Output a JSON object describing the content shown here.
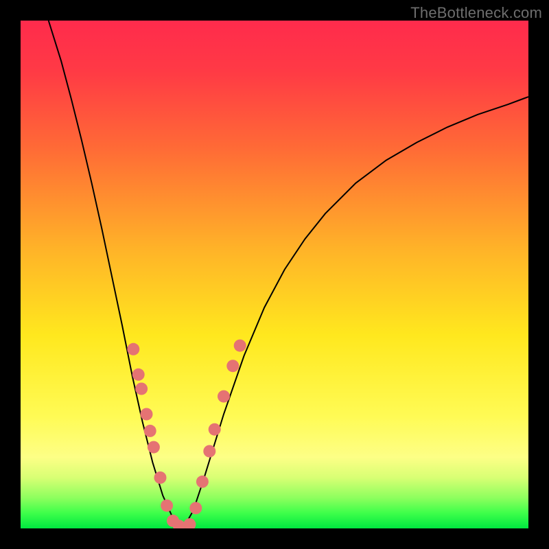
{
  "watermark": {
    "text": "TheBottleneck.com"
  },
  "gradient": {
    "stops": [
      {
        "offset": 0.0,
        "color": "#ff2b4c"
      },
      {
        "offset": 0.1,
        "color": "#ff3a45"
      },
      {
        "offset": 0.25,
        "color": "#ff6a36"
      },
      {
        "offset": 0.45,
        "color": "#ffb328"
      },
      {
        "offset": 0.62,
        "color": "#ffe81e"
      },
      {
        "offset": 0.78,
        "color": "#fffb55"
      },
      {
        "offset": 0.86,
        "color": "#fdff86"
      },
      {
        "offset": 0.9,
        "color": "#d8ff74"
      },
      {
        "offset": 0.94,
        "color": "#8dff5e"
      },
      {
        "offset": 0.97,
        "color": "#3dff4a"
      },
      {
        "offset": 1.0,
        "color": "#00e840"
      }
    ]
  },
  "curve_style": {
    "stroke": "#000000",
    "width": 2.0
  },
  "marker_style": {
    "fill": "#e57373",
    "radius": 9
  },
  "markers_left": [
    {
      "x": 0.222,
      "y": 0.647
    },
    {
      "x": 0.232,
      "y": 0.697
    },
    {
      "x": 0.238,
      "y": 0.725
    },
    {
      "x": 0.248,
      "y": 0.775
    },
    {
      "x": 0.255,
      "y": 0.808
    },
    {
      "x": 0.262,
      "y": 0.84
    },
    {
      "x": 0.275,
      "y": 0.9
    },
    {
      "x": 0.288,
      "y": 0.955
    },
    {
      "x": 0.3,
      "y": 0.985
    },
    {
      "x": 0.312,
      "y": 0.995
    }
  ],
  "markers_right": [
    {
      "x": 0.333,
      "y": 0.992
    },
    {
      "x": 0.345,
      "y": 0.96
    },
    {
      "x": 0.358,
      "y": 0.908
    },
    {
      "x": 0.372,
      "y": 0.848
    },
    {
      "x": 0.382,
      "y": 0.805
    },
    {
      "x": 0.4,
      "y": 0.74
    },
    {
      "x": 0.418,
      "y": 0.68
    },
    {
      "x": 0.432,
      "y": 0.64
    }
  ],
  "chart_data": {
    "type": "line",
    "title": "",
    "xlabel": "",
    "ylabel": "",
    "xlim": [
      0,
      1
    ],
    "ylim": [
      0,
      1
    ],
    "note": "x and y are normalized plot-area coordinates; y=0 is top, y=1 is bottom. Higher y = lower bottleneck (green).",
    "series": [
      {
        "name": "left-branch",
        "x": [
          0.055,
          0.08,
          0.1,
          0.12,
          0.14,
          0.16,
          0.18,
          0.2,
          0.22,
          0.24,
          0.26,
          0.28,
          0.3,
          0.31,
          0.32
        ],
        "y": [
          0.0,
          0.08,
          0.155,
          0.235,
          0.32,
          0.41,
          0.505,
          0.6,
          0.7,
          0.79,
          0.87,
          0.935,
          0.98,
          0.995,
          1.0
        ]
      },
      {
        "name": "right-branch",
        "x": [
          0.32,
          0.34,
          0.36,
          0.38,
          0.4,
          0.44,
          0.48,
          0.52,
          0.56,
          0.6,
          0.66,
          0.72,
          0.78,
          0.84,
          0.9,
          0.96,
          1.0
        ],
        "y": [
          1.0,
          0.965,
          0.905,
          0.84,
          0.775,
          0.66,
          0.565,
          0.49,
          0.43,
          0.38,
          0.32,
          0.275,
          0.24,
          0.21,
          0.185,
          0.165,
          0.15
        ]
      }
    ],
    "highlighted_points": {
      "left": [
        [
          0.222,
          0.647
        ],
        [
          0.232,
          0.697
        ],
        [
          0.238,
          0.725
        ],
        [
          0.248,
          0.775
        ],
        [
          0.255,
          0.808
        ],
        [
          0.262,
          0.84
        ],
        [
          0.275,
          0.9
        ],
        [
          0.288,
          0.955
        ],
        [
          0.3,
          0.985
        ],
        [
          0.312,
          0.995
        ]
      ],
      "right": [
        [
          0.333,
          0.992
        ],
        [
          0.345,
          0.96
        ],
        [
          0.358,
          0.908
        ],
        [
          0.372,
          0.848
        ],
        [
          0.382,
          0.805
        ],
        [
          0.4,
          0.74
        ],
        [
          0.418,
          0.68
        ],
        [
          0.432,
          0.64
        ]
      ]
    },
    "background_gradient": "vertical red→yellow→green (bottleneck severity heat)"
  }
}
